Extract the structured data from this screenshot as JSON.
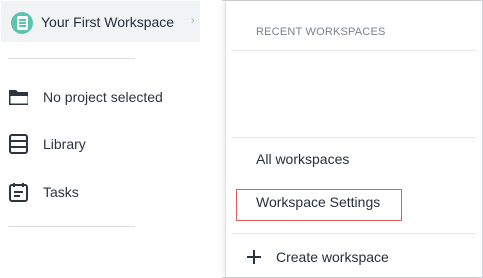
{
  "sidebar": {
    "workspace_name": "Your First Workspace",
    "workspace_chevron": "›",
    "nav": [
      {
        "label": "No project selected",
        "icon": "folder-icon"
      },
      {
        "label": "Library",
        "icon": "library-icon"
      },
      {
        "label": "Tasks",
        "icon": "tasks-icon"
      }
    ]
  },
  "workspace_menu": {
    "recent_header": "RECENT WORKSPACES",
    "all_workspaces": "All workspaces",
    "workspace_settings": "Workspace Settings",
    "create_workspace": "Create workspace",
    "create_icon": "plus-icon"
  },
  "colors": {
    "accent_logo": "#5cc3b0",
    "highlight_border": "#e25b5b",
    "switcher_bg": "#f1f3f5"
  }
}
